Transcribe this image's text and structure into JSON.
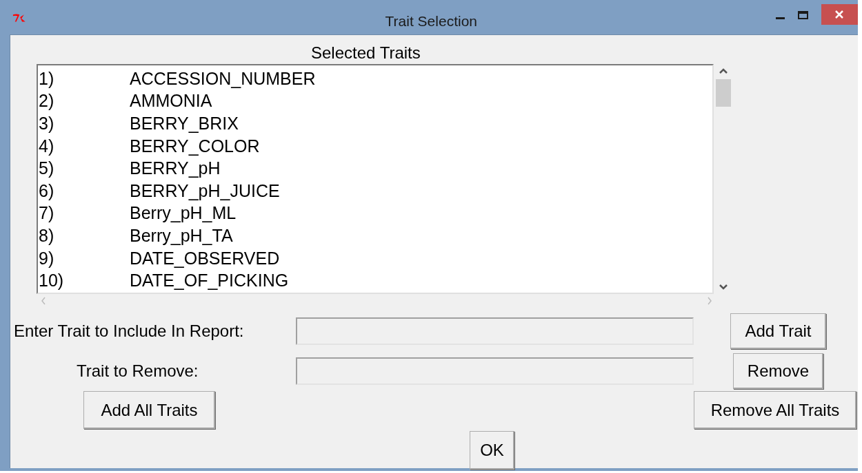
{
  "window": {
    "title": "Trait Selection"
  },
  "list_title": "Selected Traits",
  "traits": [
    {
      "number": "1)",
      "name": "ACCESSION_NUMBER"
    },
    {
      "number": "2)",
      "name": "AMMONIA"
    },
    {
      "number": "3)",
      "name": "BERRY_BRIX"
    },
    {
      "number": "4)",
      "name": "BERRY_COLOR"
    },
    {
      "number": "5)",
      "name": "BERRY_pH"
    },
    {
      "number": "6)",
      "name": "BERRY_pH_JUICE"
    },
    {
      "number": "7)",
      "name": "Berry_pH_ML"
    },
    {
      "number": "8)",
      "name": "Berry_pH_TA"
    },
    {
      "number": "9)",
      "name": "DATE_OBSERVED"
    },
    {
      "number": "10)",
      "name": "DATE_OF_PICKING"
    }
  ],
  "include_label": "Enter Trait to Include In Report:",
  "add_button": "Add Trait",
  "remove_label": "Trait to Remove:",
  "remove_button": "Remove",
  "add_all_button": "Add All Traits",
  "remove_all_button": "Remove All Traits",
  "ok_button": "OK"
}
